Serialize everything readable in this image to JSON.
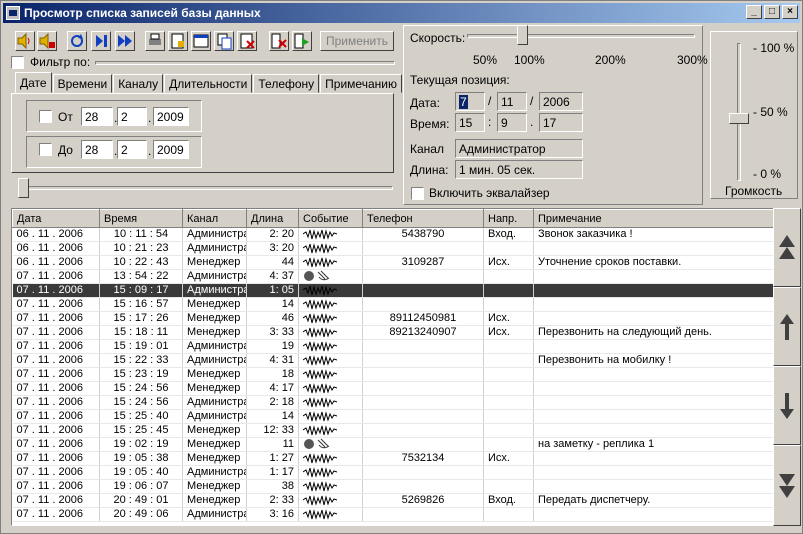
{
  "window": {
    "title": "Просмотр списка записей базы данных"
  },
  "toolbar": {
    "apply_label": "Применить"
  },
  "filter": {
    "label": "Фильтр по:",
    "checked": false
  },
  "tabs": [
    "Дате",
    "Времени",
    "Каналу",
    "Длительности",
    "Телефону",
    "Примечанию"
  ],
  "date_filter": {
    "from_label": "От",
    "from": {
      "day": "28",
      "month": "2",
      "year": "2009"
    },
    "to_label": "До",
    "to": {
      "day": "28",
      "month": "2",
      "year": "2009"
    }
  },
  "speed": {
    "label": "Скорость:",
    "ticks": [
      "50%",
      "100%",
      "200%",
      "300%"
    ],
    "value_percent": 100
  },
  "position": {
    "label": "Текущая позиция:",
    "date_label": "Дата:",
    "date": {
      "d": "7",
      "m": "11",
      "y": "2006"
    },
    "time_label": "Время:",
    "time": {
      "h": "15",
      "m": "9",
      "s": "17"
    }
  },
  "channel": {
    "label": "Канал",
    "value": "Администратор"
  },
  "length": {
    "label": "Длина:",
    "value": "1 мин. 05 сек."
  },
  "equalizer": {
    "label": "Включить эквалайзер",
    "checked": false
  },
  "volume": {
    "label": "Громкость",
    "ticks": [
      "- 100 %",
      "- 50 %",
      "- 0 %"
    ],
    "value_percent": 50
  },
  "grid": {
    "columns": [
      "Дата",
      "Время",
      "Канал",
      "Длина",
      "Событие",
      "Телефон",
      "Напр.",
      "Примечание"
    ],
    "rows": [
      [
        "06 . 11 . 2006",
        "10 : 11 : 54",
        "Администратор",
        "2: 20",
        "wave",
        "5438790",
        "Вход.",
        "Звонок заказчика !"
      ],
      [
        "06 . 11 . 2006",
        "10 : 21 : 23",
        "Администратор",
        "3: 20",
        "wave",
        "",
        "",
        ""
      ],
      [
        "06 . 11 . 2006",
        "10 : 22 : 43",
        "Менеджер",
        "44",
        "wave",
        "3109287",
        "Исх.",
        "Уточнение сроков поставки."
      ],
      [
        "07 . 11 . 2006",
        "13 : 54 : 22",
        "Администратор",
        "4: 37",
        "icons",
        "",
        "",
        ""
      ],
      [
        "07 . 11 . 2006",
        "15 : 09 : 17",
        "Администратор",
        "1: 05",
        "wave",
        "",
        "",
        ""
      ],
      [
        "07 . 11 . 2006",
        "15 : 16 : 57",
        "Менеджер",
        "14",
        "wave",
        "",
        "",
        ""
      ],
      [
        "07 . 11 . 2006",
        "15 : 17 : 26",
        "Менеджер",
        "46",
        "wave",
        "89112450981",
        "Исх.",
        ""
      ],
      [
        "07 . 11 . 2006",
        "15 : 18 : 11",
        "Менеджер",
        "3: 33",
        "wave",
        "89213240907",
        "Исх.",
        "Перезвонить  на следующий день."
      ],
      [
        "07 . 11 . 2006",
        "15 : 19 : 01",
        "Администратор",
        "19",
        "wave",
        "",
        "",
        ""
      ],
      [
        "07 . 11 . 2006",
        "15 : 22 : 33",
        "Администратор",
        "4: 31",
        "wave",
        "",
        "",
        "Перезвонить на мобилку !"
      ],
      [
        "07 . 11 . 2006",
        "15 : 23 : 19",
        "Менеджер",
        "18",
        "wave",
        "",
        "",
        ""
      ],
      [
        "07 . 11 . 2006",
        "15 : 24 : 56",
        "Менеджер",
        "4: 17",
        "wave",
        "",
        "",
        ""
      ],
      [
        "07 . 11 . 2006",
        "15 : 24 : 56",
        "Администратор",
        "2: 18",
        "wave",
        "",
        "",
        ""
      ],
      [
        "07 . 11 . 2006",
        "15 : 25 : 40",
        "Администратор",
        "14",
        "wave",
        "",
        "",
        ""
      ],
      [
        "07 . 11 . 2006",
        "15 : 25 : 45",
        "Менеджер",
        "12: 33",
        "wave",
        "",
        "",
        ""
      ],
      [
        "07 . 11 . 2006",
        "19 : 02 : 19",
        "Менеджер",
        "11",
        "icons",
        "",
        "",
        "на заметку - реплика 1"
      ],
      [
        "07 . 11 . 2006",
        "19 : 05 : 38",
        "Менеджер",
        "1: 27",
        "wave",
        "7532134",
        "Исх.",
        ""
      ],
      [
        "07 . 11 . 2006",
        "19 : 05 : 40",
        "Администратор",
        "1: 17",
        "wave",
        "",
        "",
        ""
      ],
      [
        "07 . 11 . 2006",
        "19 : 06 : 07",
        "Менеджер",
        "38",
        "wave",
        "",
        "",
        ""
      ],
      [
        "07 . 11 . 2006",
        "20 : 49 : 01",
        "Менеджер",
        "2: 33",
        "wave",
        "5269826",
        "Вход.",
        "Передать диспетчеру."
      ],
      [
        "07 . 11 . 2006",
        "20 : 49 : 06",
        "Администратор",
        "3: 16",
        "wave",
        "",
        "",
        ""
      ]
    ],
    "selected_row": 4
  },
  "nav_buttons": [
    "first-icon",
    "prev-icon",
    "next-icon",
    "last-icon"
  ]
}
